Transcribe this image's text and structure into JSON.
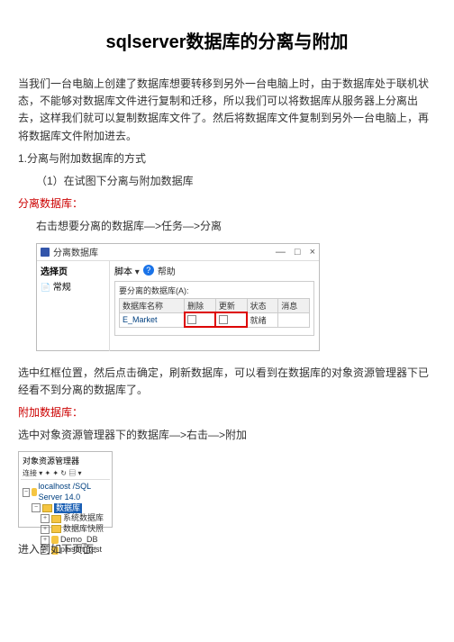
{
  "title": "sqlserver数据库的分离与附加",
  "para_intro": "当我们一台电脑上创建了数据库想要转移到另外一台电脑上时，由于数据库处于联机状态，不能够对数据库文件进行复制和迁移，所以我们可以将数据库从服务器上分离出去，这样我们就可以复制数据库文件了。然后将数据库文件复制到另外一台电脑上，再将数据库文件附加进去。",
  "step1_heading": "1.分离与附加数据库的方式",
  "step1_sub": "（1）在试图下分离与附加数据库",
  "detach_label": "分离数据库：",
  "detach_op": "右击想要分离的数据库—>任务—>分离",
  "fig1": {
    "window_title": "分离数据库",
    "ctrl_min": "—",
    "ctrl_max": "□",
    "ctrl_close": "×",
    "left_header": "选择页",
    "left_item": "常规",
    "toolbar_script": "脚本",
    "toolbar_help": "?",
    "toolbar_help_text": "帮助",
    "panel_label": "要分离的数据库(A):",
    "cols": {
      "c1": "数据库名称",
      "c2": "删除",
      "c3": "更新",
      "c4": "状态",
      "c5": "消息"
    },
    "row": {
      "name": "E_Market",
      "status": "就绪"
    }
  },
  "after_fig1": "选中红框位置，然后点击确定，刷新数据库，可以看到在数据库的对象资源管理器下已经看不到分离的数据库了。",
  "attach_label": "附加数据库：",
  "attach_op": "选中对象资源管理器下的数据库—>右击—>附加",
  "fig2": {
    "title": "对象资源管理器",
    "toolbar": "连接 ▾  ✦  ✦  ↻  ▤  ▾",
    "root": "localhost /SQL Server 14.0",
    "node_db": "数据库",
    "node_sysdb": "系统数据库",
    "node_snap": "数据库快照",
    "node_demo": "Demo_DB",
    "node_plusoft": "plusoft_test"
  },
  "enter_page": "进入到如下页面:"
}
